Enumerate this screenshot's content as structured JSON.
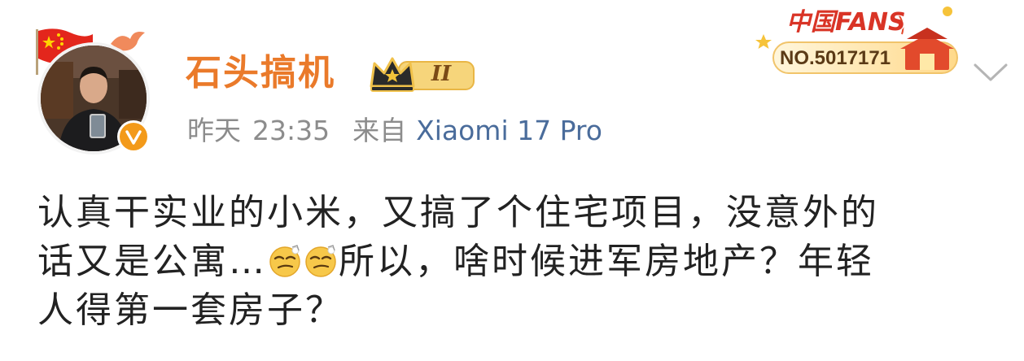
{
  "fans_badge": {
    "title": "中国FANS",
    "number": "NO.5017171"
  },
  "author": {
    "name": "石头搞机",
    "vip_level": "II"
  },
  "meta": {
    "time_label": "昨天",
    "time": "23:35",
    "from_label": "来自",
    "device": "Xiaomi 17 Pro"
  },
  "post": {
    "line1": "认真干实业的小米，又搞了个住宅项目，没意外的",
    "line2_part1": "话又是公寓…",
    "line2_part2": "所以，啥时候进军房地产？年轻",
    "line3": "人得第一套房子？",
    "emoji_name": "doge-smirk-emoji"
  },
  "colors": {
    "name": "#ea7a2a",
    "device": "#4a6c9b",
    "meta": "#8c8c8c",
    "text": "#222222",
    "verified": "#f39a1a"
  }
}
